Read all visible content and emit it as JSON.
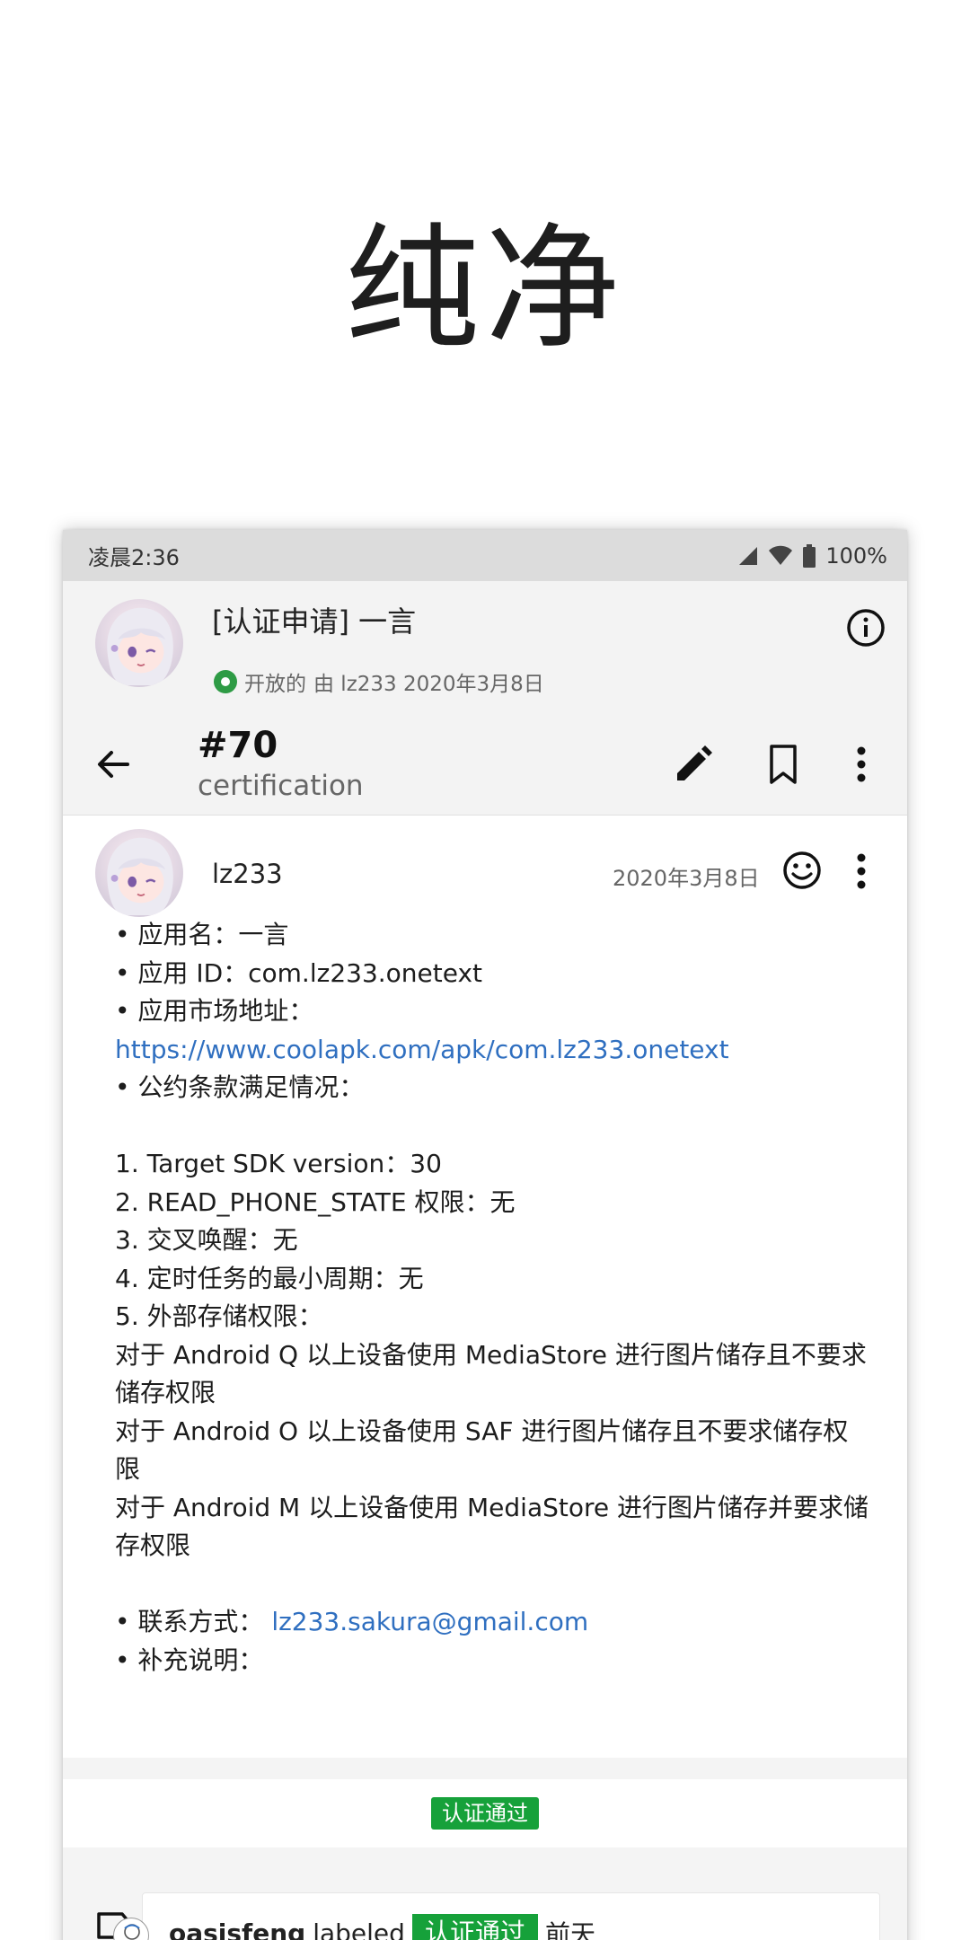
{
  "hero": {
    "title": "纯净"
  },
  "status_bar": {
    "time": "凌晨2:36",
    "battery": "100%"
  },
  "issue": {
    "title": "[认证申请] 一言",
    "state": "开放的",
    "meta": "由 lz233 2020年3月8日",
    "number": "#70",
    "repo_label": "certification"
  },
  "comment": {
    "author": "lz233",
    "date": "2020年3月8日",
    "lines": [
      "• 应用名：一言",
      "• 应用 ID：com.lz233.onetext",
      "• 应用市场地址：",
      "https://www.coolapk.com/apk/com.lz233.onetext",
      "• 公约条款满足情况：",
      "",
      "1. Target SDK version：30",
      "2. READ_PHONE_STATE 权限：无",
      "3. 交叉唤醒：无",
      "4. 定时任务的最小周期：无",
      "5. 外部存储权限：",
      "对于 Android Q 以上设备使用 MediaStore 进行图片储存且不要求",
      "储存权限",
      "对于 Android O 以上设备使用 SAF 进行图片储存且不要求储存权",
      "限",
      "对于 Android M 以上设备使用 MediaStore 进行图片储存并要求储",
      "存权限",
      "",
      "• 联系方式： ",
      "• 补充说明："
    ],
    "contact_email": "lz233.sakura@gmail.com"
  },
  "labels": {
    "applied": "认证通过"
  },
  "event": {
    "user": "oasisfeng",
    "action": "labeled",
    "label": "认证通过",
    "time": "前天"
  },
  "colors": {
    "link": "#2f6fc0",
    "label_green": "#16a13a",
    "open_green": "#2e9b45"
  },
  "icons": [
    "signal-icon",
    "wifi-icon",
    "battery-icon",
    "info-icon",
    "back-arrow-icon",
    "edit-pencil-icon",
    "bookmark-icon",
    "more-vert-icon",
    "smiley-icon",
    "tag-icon"
  ]
}
